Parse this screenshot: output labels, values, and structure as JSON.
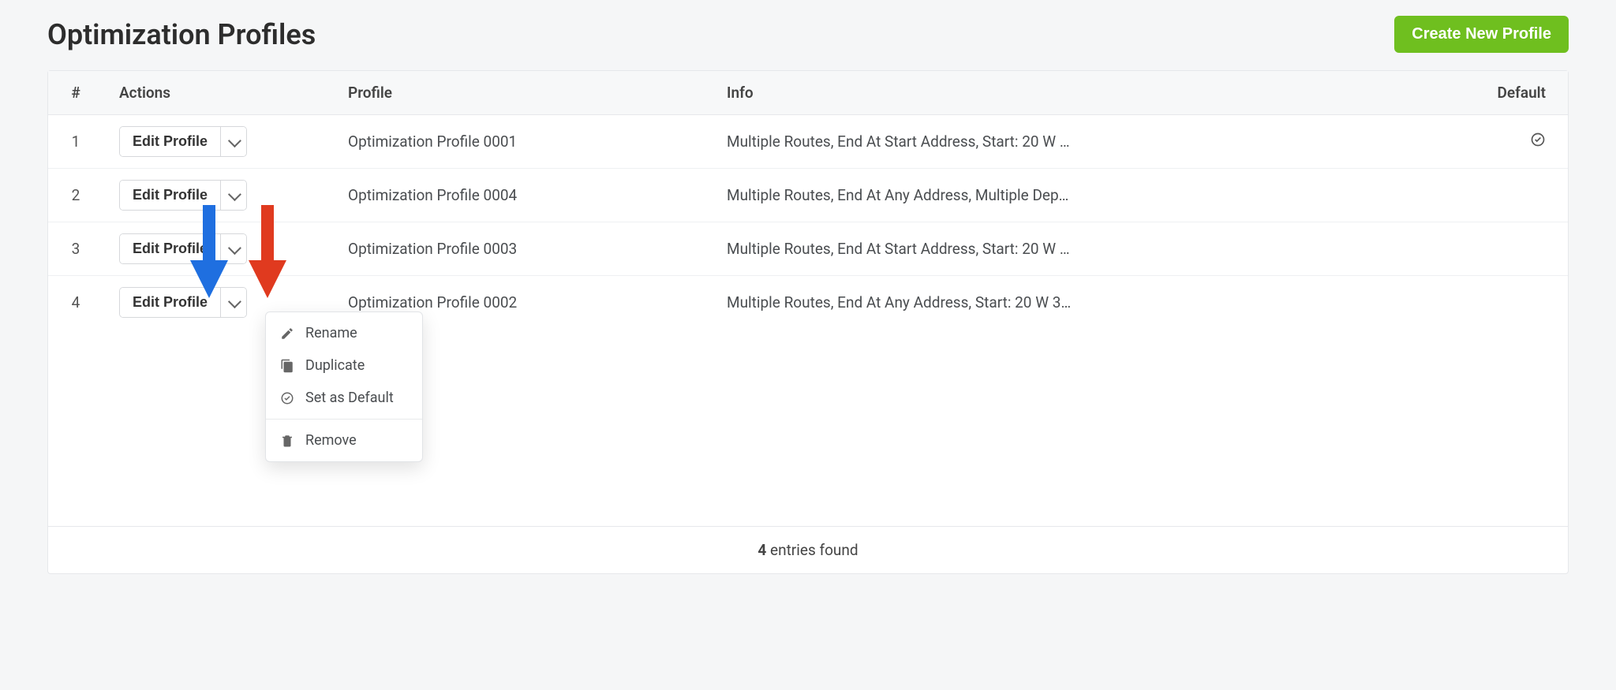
{
  "header": {
    "title": "Optimization Profiles",
    "create_label": "Create New Profile"
  },
  "table": {
    "columns": {
      "num": "#",
      "actions": "Actions",
      "profile": "Profile",
      "info": "Info",
      "default": "Default"
    },
    "edit_label": "Edit Profile",
    "rows": [
      {
        "n": "1",
        "profile": "Optimization Profile 0001",
        "info": "Multiple Routes, End At Start Address, Start: 20 W …",
        "default": true
      },
      {
        "n": "2",
        "profile": "Optimization Profile 0004",
        "info": "Multiple Routes, End At Any Address, Multiple Dep…",
        "default": false
      },
      {
        "n": "3",
        "profile": "Optimization Profile 0003",
        "info": "Multiple Routes, End At Start Address, Start: 20 W …",
        "default": false
      },
      {
        "n": "4",
        "profile": "Optimization Profile 0002",
        "info": "Multiple Routes, End At Any Address, Start: 20 W 3…",
        "default": false
      }
    ]
  },
  "dropdown": {
    "rename": "Rename",
    "duplicate": "Duplicate",
    "set_default": "Set as Default",
    "remove": "Remove"
  },
  "footer": {
    "count": "4",
    "suffix": " entries found"
  },
  "annotations": {
    "arrow_blue": "blue-arrow",
    "arrow_red": "red-arrow"
  }
}
